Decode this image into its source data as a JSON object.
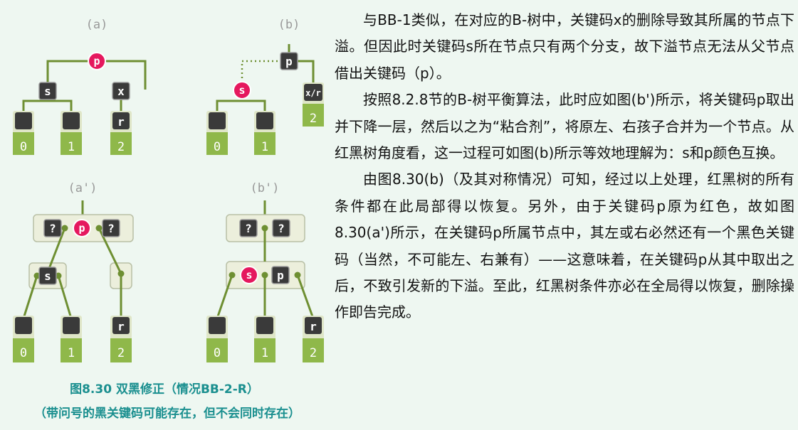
{
  "figure": {
    "labels": {
      "a": "(a)",
      "b": "(b)",
      "a_prime": "(a')",
      "b_prime": "(b')"
    },
    "keys": {
      "p": "p",
      "s": "s",
      "x": "x",
      "r": "r",
      "xr": "x/r",
      "q": "?"
    },
    "subtrees": {
      "0": "0",
      "1": "1",
      "2": "2"
    },
    "colors": {
      "red_node": "#e5185e",
      "black_node": "#3a3a3a",
      "green_leaf": "#8fb84a",
      "edge": "#6e8f32",
      "box_fill": "#ecefdc"
    }
  },
  "caption": {
    "line1": "图8.30  双黑修正（情况BB-2-R）",
    "line2": "（带问号的黑关键码可能存在，但不会同时存在）"
  },
  "text": {
    "p1": "与BB-1类似，在对应的B-树中，关键码x的删除导致其所属的节点下溢。但因此时关键码s所在节点只有两个分支，故下溢节点无法从父节点借出关键码（p）。",
    "p2": "按照8.2.8节的B-树平衡算法，此时应如图(b')所示，将关键码p取出并下降一层，然后以之为“粘合剂”，将原左、右孩子合并为一个节点。从红黑树角度看，这一过程可如图(b)所示等效地理解为：s和p颜色互换。",
    "p3": "由图8.30(b)（及其对称情况）可知，经过以上处理，红黑树的所有条件都在此局部得以恢复。另外，由于关键码p原为红色，故如图8.30(a')所示，在关键码p所属节点中，其左或右必然还有一个黑色关键码（当然，不可能左、右兼有）——这意味着，在关键码p从其中取出之后，不致引发新的下溢。至此，红黑树条件亦必在全局得以恢复，删除操作即告完成。"
  }
}
